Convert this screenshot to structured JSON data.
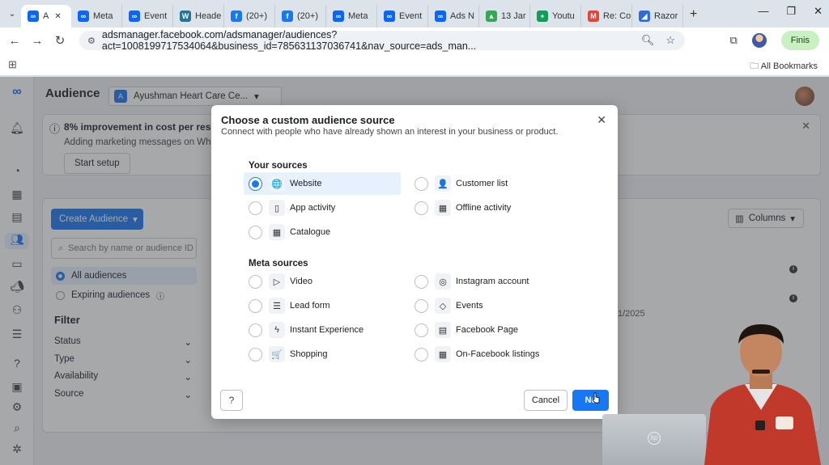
{
  "browser": {
    "tabs": [
      {
        "label": "A",
        "fav": "∞",
        "color": "#0866ff",
        "active": true
      },
      {
        "label": "Meta",
        "fav": "∞",
        "color": "#0866ff"
      },
      {
        "label": "Event",
        "fav": "∞",
        "color": "#0866ff"
      },
      {
        "label": "Heade",
        "fav": "W",
        "color": "#21759b"
      },
      {
        "label": "(20+)",
        "fav": "f",
        "color": "#1877f2"
      },
      {
        "label": "(20+)",
        "fav": "f",
        "color": "#1877f2"
      },
      {
        "label": "Meta",
        "fav": "∞",
        "color": "#0866ff"
      },
      {
        "label": "Event",
        "fav": "∞",
        "color": "#0866ff"
      },
      {
        "label": "Ads N",
        "fav": "∞",
        "color": "#0866ff"
      },
      {
        "label": "13 Jar",
        "fav": "▲",
        "color": "#34a853"
      },
      {
        "label": "Youtu",
        "fav": "+",
        "color": "#0f9d58"
      },
      {
        "label": "Re: Co",
        "fav": "M",
        "color": "#ea4335"
      },
      {
        "label": "Razor",
        "fav": "◢",
        "color": "#2d6cdf"
      }
    ],
    "url": "adsmanager.facebook.com/adsmanager/audiences?act=1008199717534064&business_id=785631137036741&nav_source=ads_man...",
    "finish_label": "Finis",
    "all_bookmarks": "All Bookmarks"
  },
  "page": {
    "title": "Audience",
    "account_badge": "A",
    "account_name": "Ayushman Heart Care Ce...",
    "banner_title": "8% improvement in cost per result w",
    "banner_sub": "Adding marketing messages on WhatsA",
    "banner_button": "Start setup",
    "create_button": "Create Audience",
    "search_placeholder": "Search by name or audience ID",
    "all_audiences": "All audiences",
    "expiring_audiences": "Expiring audiences",
    "filter_heading": "Filter",
    "filters": [
      "Status",
      "Type",
      "Availability",
      "Source"
    ],
    "columns_button": "Columns",
    "date_fragment": "1/2025"
  },
  "modal": {
    "title": "Choose a custom audience source",
    "subtitle": "Connect with people who have already shown an interest in your business or product.",
    "your_sources_heading": "Your sources",
    "meta_sources_heading": "Meta sources",
    "your_sources": [
      {
        "label": "Website",
        "icon": "globe-icon",
        "glyph": "🌐",
        "selected": true
      },
      {
        "label": "Customer list",
        "icon": "person-list-icon",
        "glyph": "👤"
      },
      {
        "label": "App activity",
        "icon": "mobile-icon",
        "glyph": "▯"
      },
      {
        "label": "Offline activity",
        "icon": "store-icon",
        "glyph": "▦"
      },
      {
        "label": "Catalogue",
        "icon": "grid-icon",
        "glyph": "▦"
      }
    ],
    "meta_sources": [
      {
        "label": "Video",
        "icon": "play-icon",
        "glyph": "▷"
      },
      {
        "label": "Instagram account",
        "icon": "instagram-icon",
        "glyph": "◎"
      },
      {
        "label": "Lead form",
        "icon": "list-icon",
        "glyph": "☰"
      },
      {
        "label": "Events",
        "icon": "tag-icon",
        "glyph": "◇"
      },
      {
        "label": "Instant Experience",
        "icon": "lightning-icon",
        "glyph": "ϟ"
      },
      {
        "label": "Facebook Page",
        "icon": "page-icon",
        "glyph": "▤"
      },
      {
        "label": "Shopping",
        "icon": "cart-icon",
        "glyph": "🛒"
      },
      {
        "label": "On-Facebook listings",
        "icon": "storefront-icon",
        "glyph": "▦"
      }
    ],
    "cancel_label": "Cancel",
    "next_label": "Ne"
  },
  "colors": {
    "accent": "#1877f2",
    "selected_bg": "#e7f0fd"
  }
}
